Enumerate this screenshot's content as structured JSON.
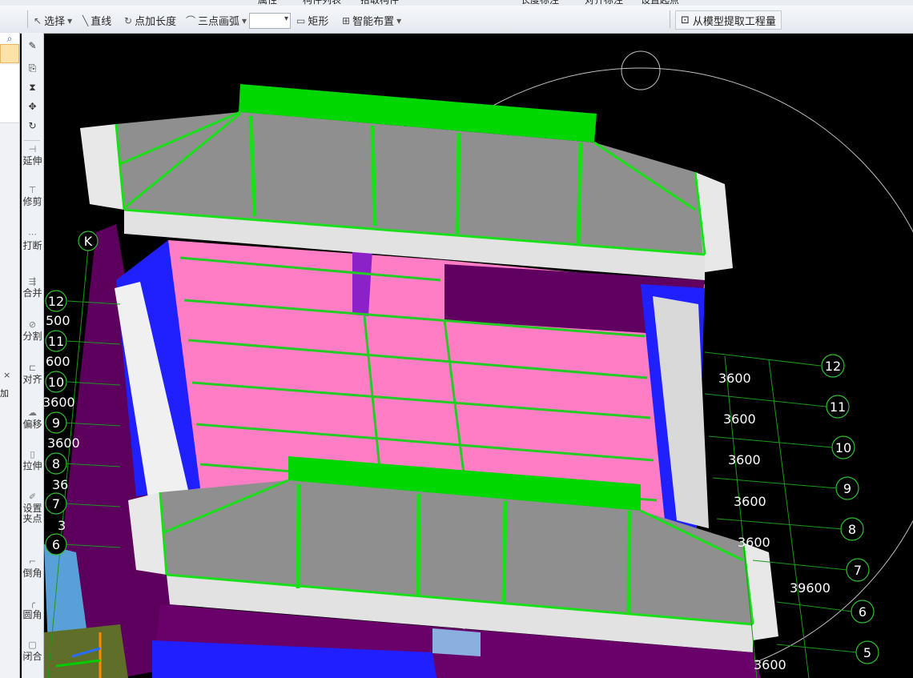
{
  "toolbar": {
    "select_label": "选择",
    "line_label": "直线",
    "point_length_label": "点加长度",
    "arc_label": "三点画弧",
    "rect_label": "矩形",
    "smart_layout_label": "智能布置",
    "extract_label": "从模型提取工程量",
    "top_partial": [
      "属性",
      "构件列表",
      "拾取构件",
      "长度标注",
      "对齐标注",
      "设置起点"
    ]
  },
  "side_tools": [
    {
      "label": "延伸",
      "icon": "extend-icon"
    },
    {
      "label": "修剪",
      "icon": "trim-icon"
    },
    {
      "label": "打断",
      "icon": "break-icon"
    },
    {
      "label": "合并",
      "icon": "merge-icon"
    },
    {
      "label": "分割",
      "icon": "split-icon"
    },
    {
      "label": "对齐",
      "icon": "align-icon"
    },
    {
      "label": "偏移",
      "icon": "offset-icon"
    },
    {
      "label": "拉伸",
      "icon": "stretch-icon"
    },
    {
      "label": "设置夹点",
      "icon": "grip-icon"
    },
    {
      "label": "倒角",
      "icon": "chamfer-icon"
    },
    {
      "label": "圆角",
      "icon": "fillet-icon"
    },
    {
      "label": "闭合",
      "icon": "close-icon"
    }
  ],
  "left_pane": {
    "add_label": "加",
    "close_glyph": "×"
  },
  "axis": {
    "corner_label": "K",
    "right_labels": [
      "12",
      "11",
      "10",
      "9",
      "8",
      "7",
      "6",
      "5"
    ],
    "left_labels": [
      "12",
      "11",
      "10",
      "9",
      "8",
      "7",
      "6"
    ],
    "right_spacings": [
      "3600",
      "3600",
      "3600",
      "3600",
      "3600"
    ],
    "right_bottom_spacing": "3600",
    "right_total": "39600",
    "left_spacings": [
      "500",
      "600",
      "3600",
      "3600",
      "36",
      "3"
    ]
  },
  "colors": {
    "roof": "#8c8c8c",
    "ridge": "#00d100",
    "wall_pink": "#ff7dc5",
    "purple": "#6a006a",
    "blue": "#1f1fff",
    "eave": "#dcdcdc"
  }
}
